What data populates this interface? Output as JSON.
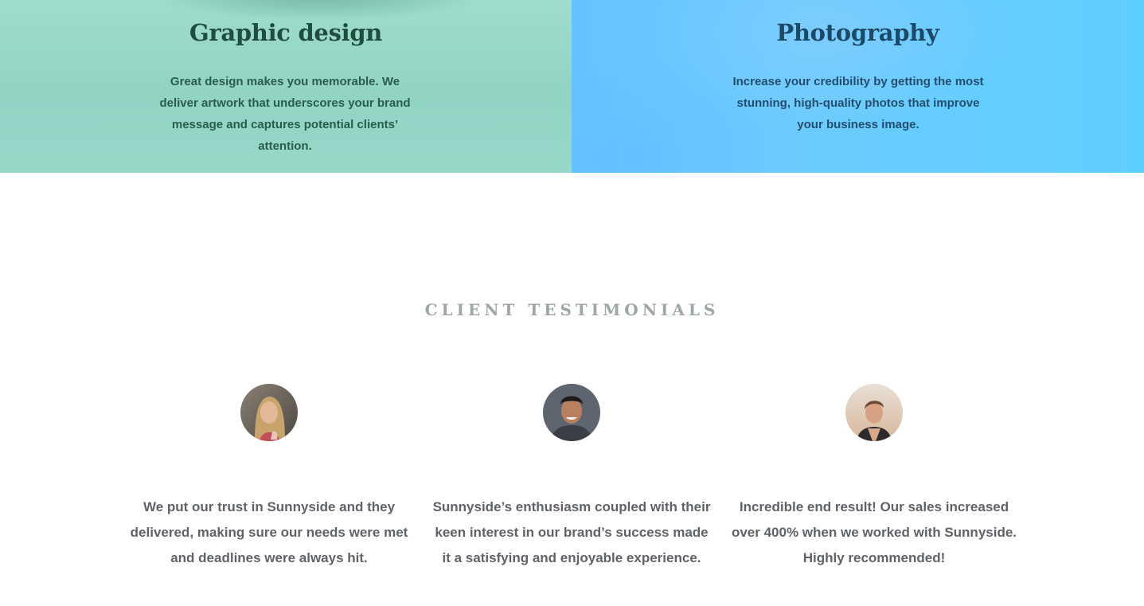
{
  "services": [
    {
      "title": "Graphic design",
      "description": "Great design makes you memorable. We deliver artwork that underscores your brand message and captures potential clients’ attention."
    },
    {
      "title": "Photography",
      "description": "Increase your credibility by getting the most stunning, high-quality photos that improve your business image."
    }
  ],
  "testimonials": {
    "heading": "CLIENT TESTIMONIALS",
    "items": [
      {
        "quote": "We put our trust in Sunnyside and they delivered, making sure our needs were met and deadlines were always hit."
      },
      {
        "quote": "Sunnyside’s enthusiasm coupled with their keen interest in our brand’s success made it a satisfying and enjoyable experience."
      },
      {
        "quote": "Incredible end result! Our sales increased over 400% when we worked with Sunnyside. Highly recommended!"
      }
    ]
  },
  "colors": {
    "graphic_design_bg": "#91d4c4",
    "photography_bg": "#5dcfff",
    "graphic_design_title": "#1f4e3e",
    "photography_title": "#1a4a68",
    "heading_grey": "#9ea7a8",
    "quote_text": "#5f6368"
  }
}
